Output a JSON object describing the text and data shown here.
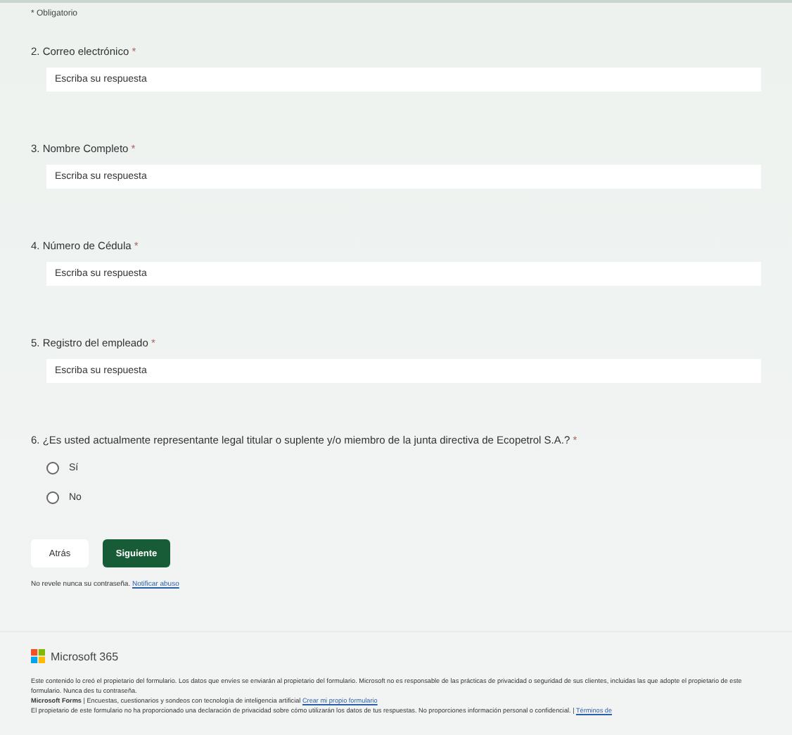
{
  "required_note": "* Obligatorio",
  "questions": [
    {
      "kind": "text",
      "number": "2.",
      "label": "Correo electrónico",
      "required_mark": "*",
      "placeholder": "Escriba su respuesta"
    },
    {
      "kind": "text",
      "number": "3.",
      "label": "Nombre Completo",
      "required_mark": "*",
      "placeholder": "Escriba su respuesta"
    },
    {
      "kind": "text",
      "number": "4.",
      "label": "Número de Cédula",
      "required_mark": "*",
      "placeholder": "Escriba su respuesta"
    },
    {
      "kind": "text",
      "number": "5.",
      "label": "Registro del empleado",
      "required_mark": "*",
      "placeholder": "Escriba su respuesta"
    },
    {
      "kind": "choice",
      "number": "6.",
      "label": "¿Es usted actualmente representante legal titular o suplente y/o miembro de la junta directiva de Ecopetrol S.A.?",
      "required_mark": "*",
      "options": [
        {
          "label": "Sí",
          "selected": false
        },
        {
          "label": "No",
          "selected": false
        }
      ]
    }
  ],
  "buttons": {
    "back": "Atrás",
    "next": "Siguiente"
  },
  "password_note": {
    "text": "No revele nunca su contraseña.",
    "link": "Notificar abuso"
  },
  "footer": {
    "brand": "Microsoft 365",
    "disclaimer": "Este contenido lo creó el propietario del formulario. Los datos que envíes se enviarán al propietario del formulario. Microsoft no es responsable de las prácticas de privacidad o seguridad de sus clientes, incluidas las que adopte el propietario de este formulario. Nunca des tu contraseña.",
    "forms_line": {
      "brand": "Microsoft Forms",
      "text": "| Encuestas, cuestionarios y sondeos con tecnología de inteligencia artificial",
      "link": "Crear mi propio formulario"
    },
    "privacy_line": {
      "text": "El propietario de este formulario no ha proporcionado una declaración de privacidad sobre cómo utilizarán los datos de tus respuestas. No proporciones información personal o confidencial. |",
      "link": "Términos de"
    }
  }
}
